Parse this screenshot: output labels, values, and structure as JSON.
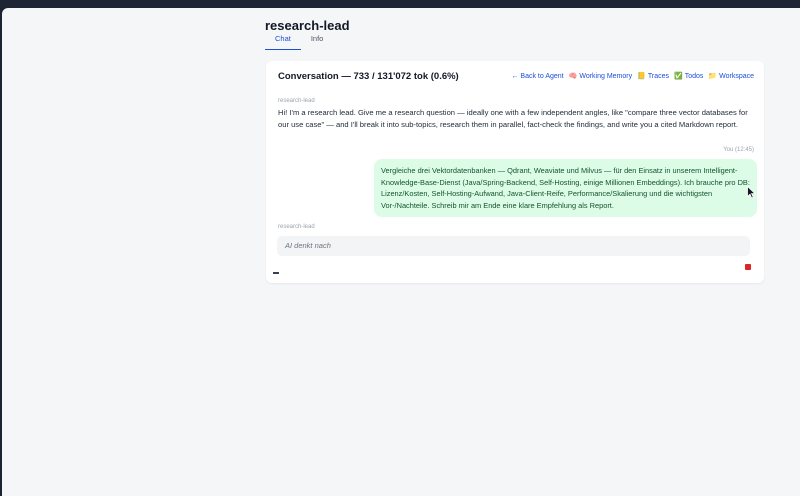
{
  "page": {
    "title": "research-lead"
  },
  "tabs": [
    {
      "label": "Chat",
      "active": true
    },
    {
      "label": "Info",
      "active": false
    }
  ],
  "conversation": {
    "title": "Conversation — 733 / 131'072 tok (0.6%)",
    "links": {
      "back": {
        "label": "← Back to Agent"
      },
      "memory": {
        "icon": "brain-icon",
        "label": "Working Memory"
      },
      "traces": {
        "icon": "notebook-icon",
        "label": "Traces"
      },
      "todos": {
        "icon": "checkmark-icon",
        "label": "Todos"
      },
      "workspace": {
        "icon": "folder-icon",
        "label": "Workspace"
      }
    },
    "messages": [
      {
        "sender": "research-lead",
        "text": "Hi! I'm a research lead. Give me a research question — ideally one with a few independent angles, like \"compare three vector databases for our use case\" — and I'll break it into sub-topics, research them in parallel, fact-check the findings, and write you a cited Markdown report."
      },
      {
        "sender": "You (12:45)",
        "text": "Vergleiche drei Vektordatenbanken — Qdrant, Weaviate und Milvus — für den Einsatz in unserem Intelligent-Knowledge-Base-Dienst (Java/Spring-Backend, Self-Hosting, einige Millionen Embeddings). Ich brauche pro DB: Lizenz/Kosten, Self-Hosting-Aufwand, Java-Client-Reife, Performance/Skalierung und die wichtigsten Vor-/Nachteile. Schreib mir am Ende eine klare Empfehlung als Report."
      },
      {
        "sender": "research-lead",
        "status": "AI denkt nach"
      }
    ]
  },
  "colors": {
    "accent": "#1d4ed8",
    "user_bubble": "#dcfce7",
    "stop": "#dc2626"
  }
}
